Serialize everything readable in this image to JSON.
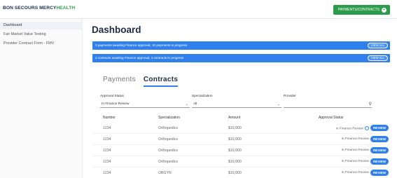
{
  "brand": {
    "part1": "BON SECOURS ",
    "part2": "MERCY",
    "part3": "HEALTH"
  },
  "topbar": {
    "action_label": "PAYMENTS/CONTRACTS"
  },
  "sidebar": {
    "items": [
      {
        "label": "Dashboard",
        "active": true
      },
      {
        "label": "Fair Market Value Testing",
        "active": false
      },
      {
        "label": "Provider Contract Form - FMV",
        "active": false
      }
    ]
  },
  "main": {
    "title": "Dashboard",
    "banners": [
      {
        "text": "3 payments awaiting Finance approval, 10 payments in progress",
        "button": "VIEW ALL"
      },
      {
        "text": "2 contracts awaiting Finance approval, 3 contracts in progress",
        "button": "VIEW ALL"
      }
    ],
    "tabs": [
      {
        "label": "Payments",
        "active": false
      },
      {
        "label": "Contracts",
        "active": true
      }
    ],
    "filters": {
      "approval_status": {
        "label": "Approval Status",
        "value": "In Finance Review"
      },
      "specialization": {
        "label": "Specialization",
        "value": "All"
      },
      "provider": {
        "label": "Provider",
        "value": ""
      }
    },
    "table": {
      "columns": [
        "Number",
        "Specialization",
        "Amount",
        "Approval Status"
      ],
      "rows": [
        {
          "number": "1234",
          "specialization": "Orthopedics",
          "amount": "$10,000",
          "status": "In Finance Review",
          "action": "REVIEW",
          "info": true
        },
        {
          "number": "1234",
          "specialization": "Orthopedics",
          "amount": "$10,000",
          "status": "In Finance Review",
          "action": "REVIEW",
          "info": false
        },
        {
          "number": "1234",
          "specialization": "Orthopedics",
          "amount": "$10,000",
          "status": "In Finance Review",
          "action": "REVIEW",
          "info": false
        },
        {
          "number": "1234",
          "specialization": "Orthopedics",
          "amount": "$10,000",
          "status": "In Finance Review",
          "action": "REVIEW",
          "info": false
        },
        {
          "number": "1234",
          "specialization": "OBGYN",
          "amount": "$10,000",
          "status": "In Finance Review",
          "action": "REVIEW",
          "info": false
        }
      ]
    }
  },
  "colors": {
    "brand_navy": "#1b2a55",
    "brand_green": "#2e9f4a",
    "accent_blue": "#2f80ed",
    "button_green": "#2c9c4b"
  }
}
